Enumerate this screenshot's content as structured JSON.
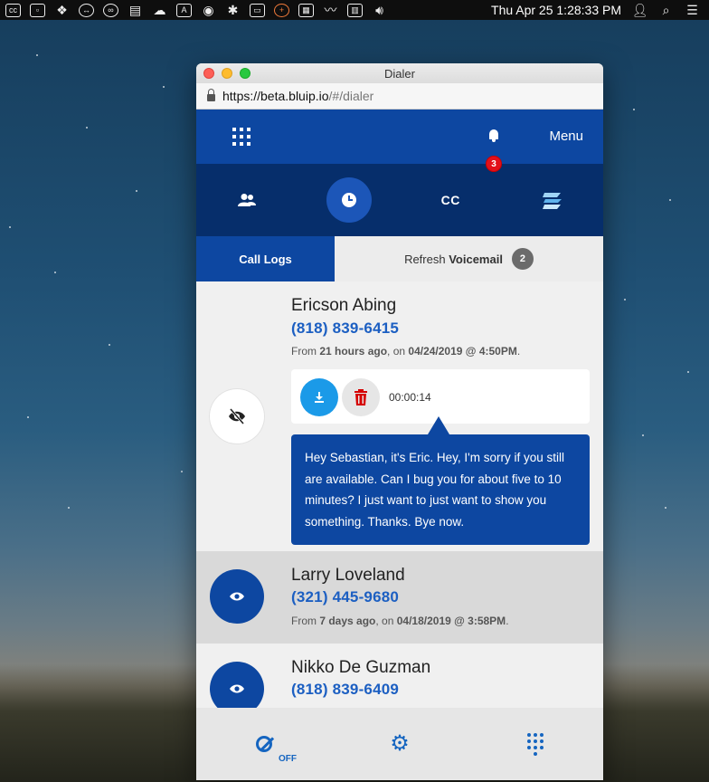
{
  "menubar": {
    "date_time": "Thu Apr 25  1:28:33 PM"
  },
  "window": {
    "title": "Dialer",
    "url_host": "https://beta.bluip.io",
    "url_path": "/#/dialer"
  },
  "app": {
    "notification_count": "3",
    "menu_label": "Menu",
    "nav_cc_label": "CC",
    "tabs": {
      "call_logs": "Call Logs",
      "refresh_prefix": "Refresh ",
      "voicemail": "Voicemail",
      "voicemail_count": "2"
    }
  },
  "entries": [
    {
      "name": "Ericson Abing",
      "phone": "(818) 839-6415",
      "meta_prefix": "From ",
      "meta_ago": "21 hours ago",
      "meta_mid": ", on ",
      "meta_when": "04/24/2019 @ 4:50PM",
      "meta_suffix": ".",
      "duration": "00:00:14",
      "transcript": "Hey Sebastian, it's Eric. Hey, I'm sorry if you still are available. Can I bug you for about five to 10 minutes? I just want to just want to show you something. Thanks. Bye now."
    },
    {
      "name": "Larry Loveland",
      "phone": "(321) 445-9680",
      "meta_prefix": "From ",
      "meta_ago": "7 days ago",
      "meta_mid": ", on ",
      "meta_when": "04/18/2019 @ 3:58PM",
      "meta_suffix": "."
    },
    {
      "name": "Nikko De Guzman",
      "phone": "(818) 839-6409"
    }
  ],
  "footer": {
    "dnd_state": "OFF"
  },
  "colors": {
    "primary": "#0d47a1",
    "nav_dark": "#062e6b",
    "link_blue": "#1c5fc2",
    "badge_red": "#e3101a"
  }
}
